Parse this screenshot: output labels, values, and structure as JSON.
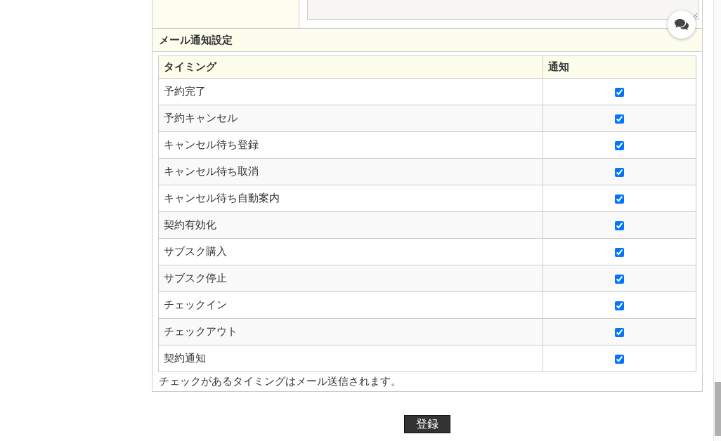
{
  "section_title": "メール通知設定",
  "table": {
    "columns": [
      "タイミング",
      "通知"
    ],
    "rows": [
      {
        "timing": "予約完了",
        "checked": true
      },
      {
        "timing": "予約キャンセル",
        "checked": true
      },
      {
        "timing": "キャンセル待ち登録",
        "checked": true
      },
      {
        "timing": "キャンセル待ち取消",
        "checked": true
      },
      {
        "timing": "キャンセル待ち自動案内",
        "checked": true
      },
      {
        "timing": "契約有効化",
        "checked": true
      },
      {
        "timing": "サブスク購入",
        "checked": true
      },
      {
        "timing": "サブスク停止",
        "checked": true
      },
      {
        "timing": "チェックイン",
        "checked": true
      },
      {
        "timing": "チェックアウト",
        "checked": true
      },
      {
        "timing": "契約通知",
        "checked": true
      }
    ]
  },
  "note": "チェックがあるタイミングはメール送信されます。",
  "submit_button": "登録"
}
